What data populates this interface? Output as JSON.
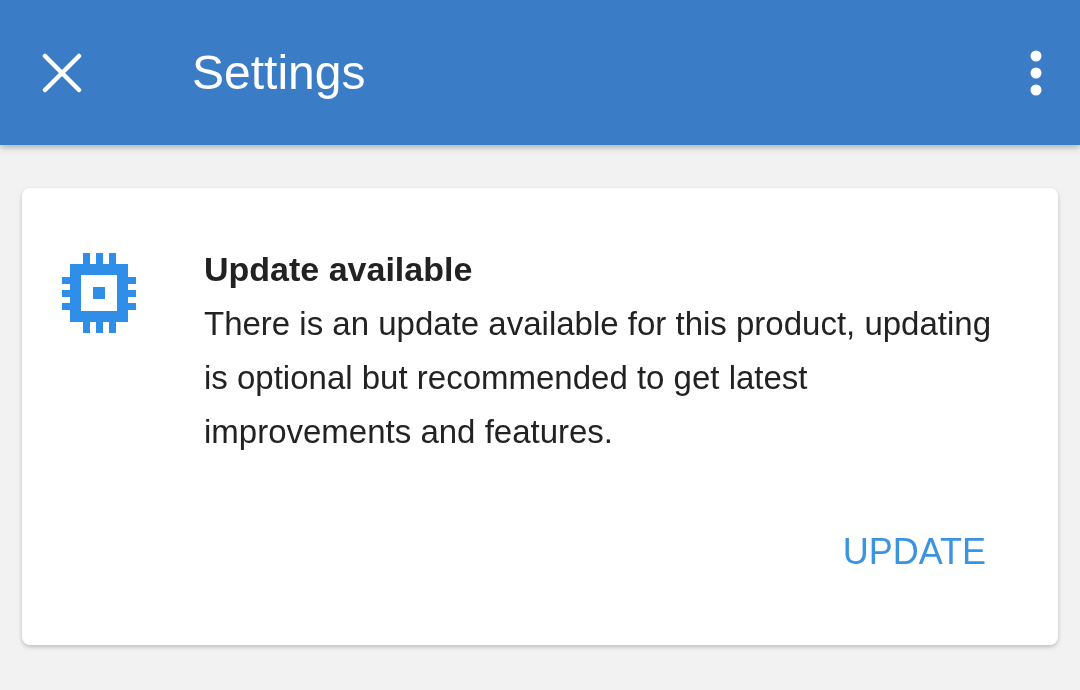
{
  "app_bar": {
    "title": "Settings"
  },
  "card": {
    "title": "Update available",
    "body": "There is an update available for this product, updating is optional but recommended to get latest improvements and features.",
    "action": "UPDATE"
  }
}
